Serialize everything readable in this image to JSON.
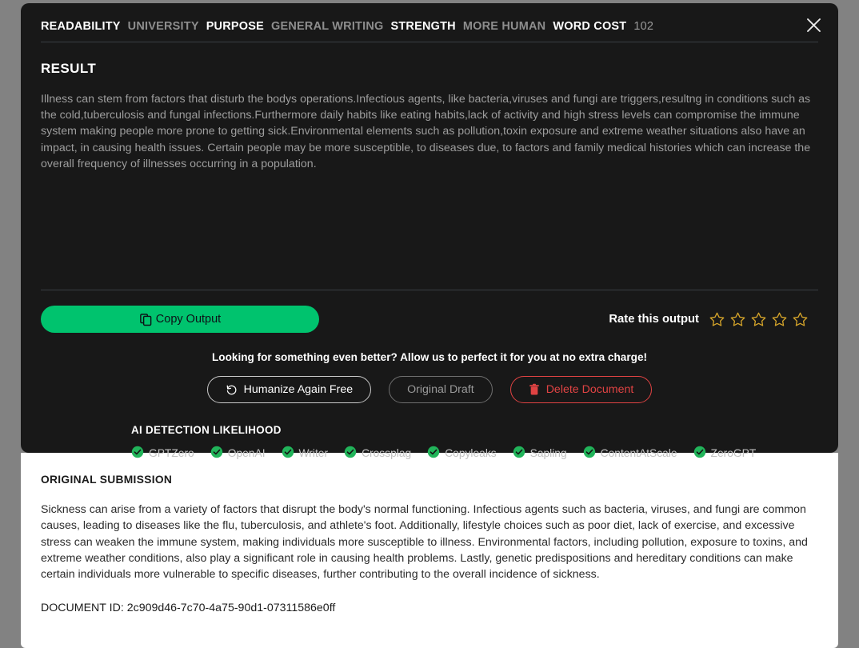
{
  "modal": {
    "close_icon": "close-icon",
    "meta": [
      {
        "key": "READABILITY",
        "value": "UNIVERSITY"
      },
      {
        "key": "PURPOSE",
        "value": "GENERAL WRITING"
      },
      {
        "key": "STRENGTH",
        "value": "MORE HUMAN"
      },
      {
        "key": "WORD COST",
        "value": "102"
      }
    ],
    "result": {
      "title": "RESULT",
      "text": "Illness can stem from factors that disturb the bodys operations.Infectious agents, like bacteria,viruses and fungi are triggers,resultng in conditions such as the cold,tuberculosis and fungal infections.Furthermore daily habits like eating habits,lack of activity and high stress levels can compromise the immune system making people more prone to getting sick.Environmental elements such as pollution,toxin exposure and extreme weather situations also have an impact, in causing health issues. Certain people may be more susceptible, to diseases due, to factors and family medical histories which can increase the overall frequency of illnesses occurring in a population."
    },
    "copy_button": {
      "label": "Copy Output",
      "icon": "copy-icon",
      "color": "#00c36e"
    },
    "rating": {
      "label": "Rate this output",
      "stars": 5,
      "filled": 0,
      "star_color": "#d6a52a"
    },
    "promo_text": "Looking for something even better? Allow us to perfect it for you at no extra charge!",
    "actions": [
      {
        "label": "Humanize Again Free",
        "icon": "history-icon",
        "style": "white"
      },
      {
        "label": "Original Draft",
        "icon": "none",
        "style": "gray"
      },
      {
        "label": "Delete Document",
        "icon": "trash-icon",
        "style": "red"
      }
    ],
    "detection": {
      "title": "AI DETECTION LIKELIHOOD",
      "check_color": "#21b45a",
      "items": [
        {
          "name": "GPTZero",
          "icon": "check-circle-icon"
        },
        {
          "name": "OpenAI",
          "icon": "check-circle-icon"
        },
        {
          "name": "Writer",
          "icon": "check-circle-icon"
        },
        {
          "name": "Crossplag",
          "icon": "check-circle-icon"
        },
        {
          "name": "Copyleaks",
          "icon": "check-circle-icon"
        },
        {
          "name": "Sapling",
          "icon": "check-circle-icon"
        },
        {
          "name": "ContentAtScale",
          "icon": "check-circle-icon"
        },
        {
          "name": "ZeroGPT",
          "icon": "check-circle-icon"
        }
      ]
    },
    "original": {
      "title": "ORIGINAL SUBMISSION",
      "text": "Sickness can arise from a variety of factors that disrupt the body's normal functioning. Infectious agents such as bacteria, viruses, and fungi are common causes, leading to diseases like the flu, tuberculosis, and athlete's foot. Additionally, lifestyle choices such as poor diet, lack of exercise, and excessive stress can weaken the immune system, making individuals more susceptible to illness. Environmental factors, including pollution, exposure to toxins, and extreme weather conditions, also play a significant role in causing health problems. Lastly, genetic predispositions and hereditary conditions can make certain individuals more vulnerable to specific diseases, further contributing to the overall incidence of sickness.",
      "document_id_label": "DOCUMENT ID:",
      "document_id_value": "2c909d46-7c70-4a75-90d1-07311586e0ff"
    }
  }
}
